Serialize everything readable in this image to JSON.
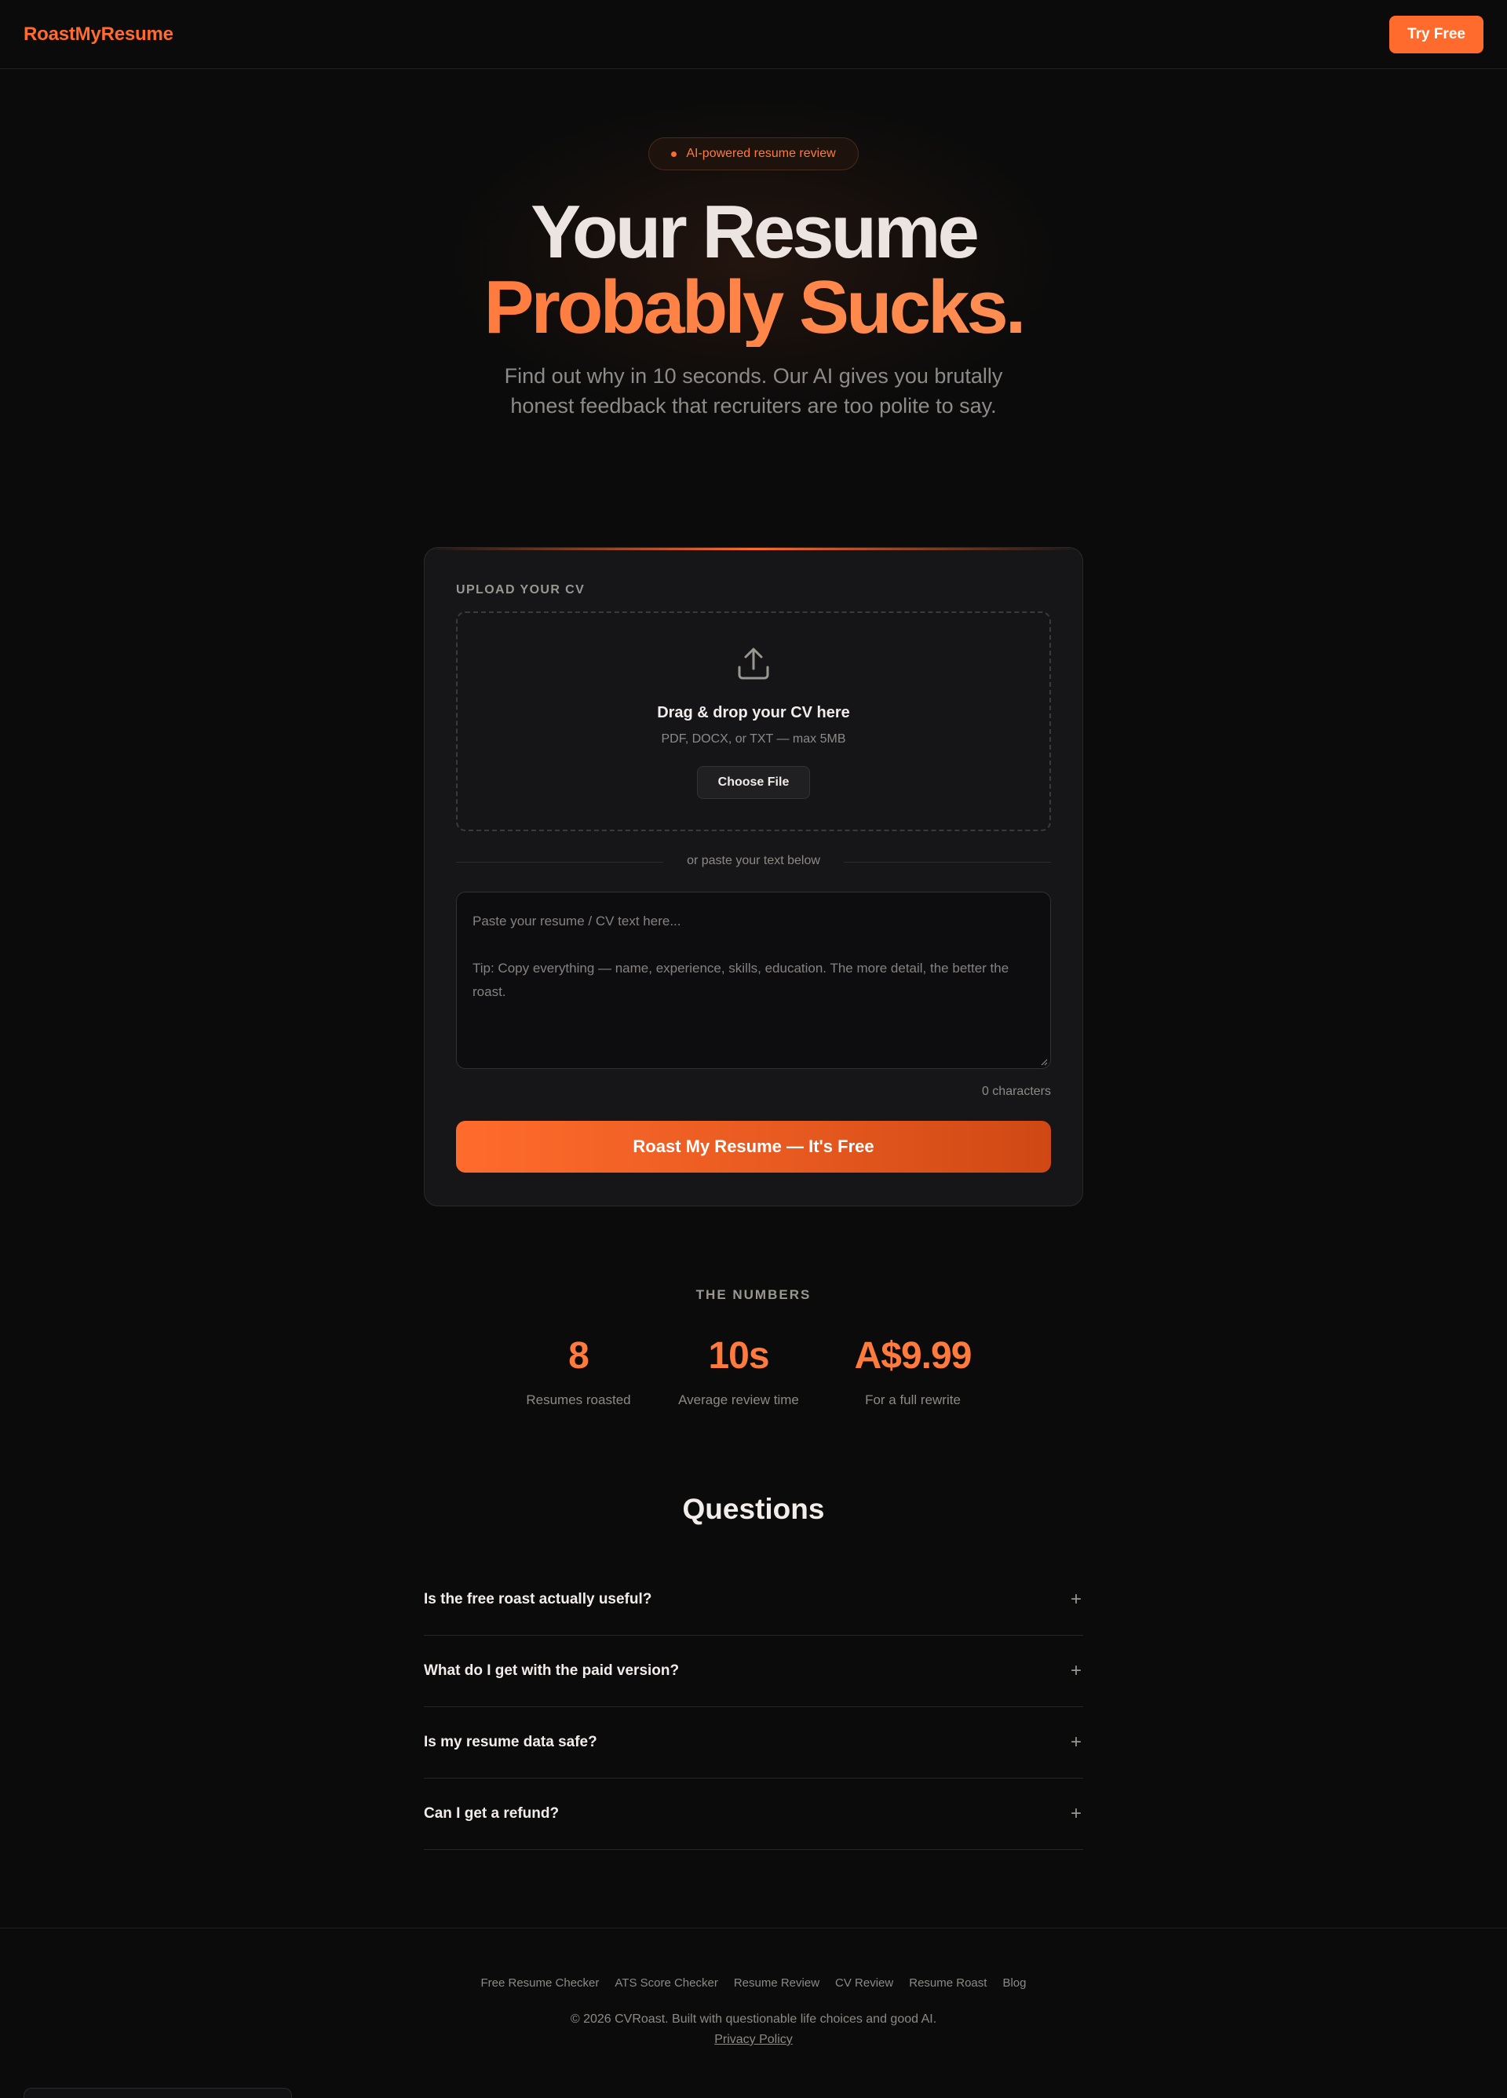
{
  "header": {
    "logo": "RoastMyResume",
    "cta": "Try Free"
  },
  "hero": {
    "badge": "AI-powered resume review",
    "title_line1": "Your Resume",
    "title_line2": "Probably Sucks.",
    "subtitle": "Find out why in 10 seconds. Our AI gives you brutally honest feedback that recruiters are too polite to say."
  },
  "upload": {
    "section_label": "UPLOAD YOUR CV",
    "icon": "upload-icon",
    "drop_title": "Drag & drop your CV here",
    "drop_hint": "PDF, DOCX, or TXT — max 5MB",
    "choose_file": "Choose File",
    "divider": "or paste your text below",
    "textarea_placeholder": "Paste your resume / CV text here...\n\nTip: Copy everything — name, experience, skills, education. The more detail, the better the roast.",
    "char_count": "0 characters",
    "submit": "Roast My Resume — It's Free"
  },
  "numbers": {
    "title": "THE NUMBERS",
    "stats": [
      {
        "value": "8",
        "label": "Resumes roasted"
      },
      {
        "value": "10s",
        "label": "Average review time"
      },
      {
        "value": "A$9.99",
        "label": "For a full rewrite"
      }
    ]
  },
  "faq": {
    "title": "Questions",
    "items": [
      {
        "question": "Is the free roast actually useful?",
        "toggle": "+"
      },
      {
        "question": "What do I get with the paid version?",
        "toggle": "+"
      },
      {
        "question": "Is my resume data safe?",
        "toggle": "+"
      },
      {
        "question": "Can I get a refund?",
        "toggle": "+"
      }
    ]
  },
  "footer": {
    "links": [
      "Free Resume Checker",
      "ATS Score Checker",
      "Resume Review",
      "CV Review",
      "Resume Roast",
      "Blog"
    ],
    "copyright": "© 2026 CVRoast. Built with questionable life choices and good AI.",
    "privacy": "Privacy Policy"
  },
  "colors": {
    "background": "#0b0b0b",
    "accent": "#ff6b2c",
    "card": "#161618"
  }
}
